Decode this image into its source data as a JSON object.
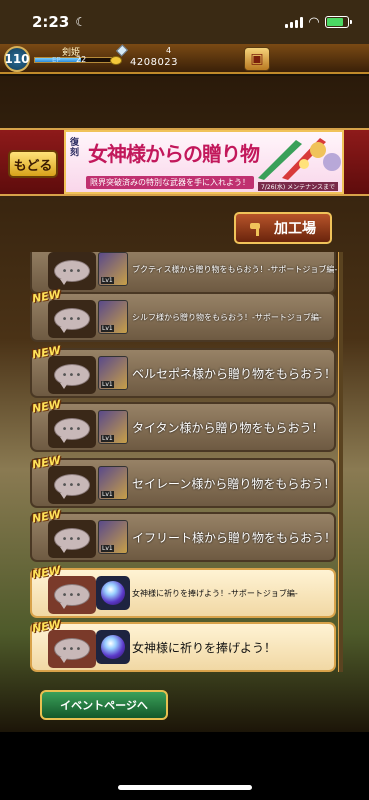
{
  "status_bar": {
    "time": "2:23",
    "moon_icon": "moon-icon",
    "wifi_icon": "wifi-icon"
  },
  "player": {
    "level": "110",
    "name": "剣姫",
    "exp_label": "EP",
    "level_value": "22",
    "gem_count": "4",
    "gold": "4208023",
    "exp_progress": 0.6
  },
  "nav": {
    "back_label": "もどる",
    "workshop_label": "加工場",
    "event_page_label": "イベントページへ"
  },
  "banner": {
    "badge": "復刻",
    "title": "女神様からの贈り物",
    "subtitle": "限界突破済みの特別な武器を手に入れよう！",
    "date": "7/26(水) メンテナンスまで"
  },
  "missions": [
    {
      "new": false,
      "text": "ブクティス様から贈り物をもらおう！-サポートジョブ編-",
      "small": true,
      "active": false,
      "icon": "weapon-item",
      "lv": "Lv1"
    },
    {
      "new": true,
      "text": "シルフ様から贈り物をもらおう！-サポートジョブ編-",
      "small": true,
      "active": false,
      "icon": "weapon-item",
      "lv": "Lv1"
    },
    {
      "new": true,
      "text": "ベルセポネ様から贈り物をもらおう！",
      "small": false,
      "active": false,
      "icon": "weapon-item",
      "lv": "Lv1"
    },
    {
      "new": true,
      "text": "タイタン様から贈り物をもらおう！",
      "small": false,
      "active": false,
      "icon": "weapon-item",
      "lv": "Lv1"
    },
    {
      "new": true,
      "text": "セイレーン様から贈り物をもらおう！",
      "small": false,
      "active": false,
      "icon": "weapon-item",
      "lv": "Lv1"
    },
    {
      "new": true,
      "text": "イフリート様から贈り物をもらおう！",
      "small": false,
      "active": false,
      "icon": "weapon-item",
      "lv": "Lv1"
    },
    {
      "new": true,
      "text": "女神様に祈りを捧げよう！-サポートジョブ編-",
      "small": true,
      "active": true,
      "icon": "orb-item",
      "lv": ""
    },
    {
      "new": true,
      "text": "女神様に祈りを捧げよう！",
      "small": false,
      "active": true,
      "icon": "orb-item",
      "lv": ""
    }
  ],
  "new_label": "NEW",
  "chat_dots": "•••"
}
